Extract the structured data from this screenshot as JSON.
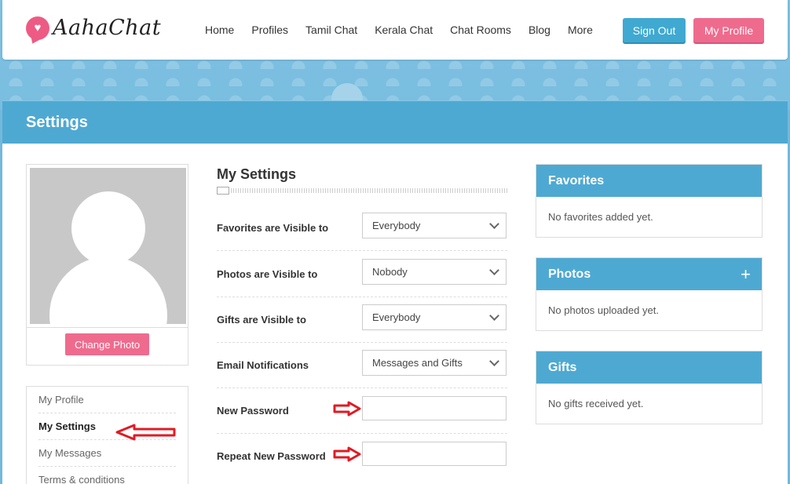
{
  "header": {
    "logo_text": "AahaChat",
    "nav": [
      "Home",
      "Profiles",
      "Tamil Chat",
      "Kerala Chat",
      "Chat Rooms",
      "Blog",
      "More"
    ],
    "sign_out": "Sign Out",
    "my_profile": "My Profile"
  },
  "page_title": "Settings",
  "photo_card": {
    "change_photo": "Change Photo"
  },
  "side_menu": {
    "items": [
      {
        "label": "My Profile",
        "active": false
      },
      {
        "label": "My Settings",
        "active": true
      },
      {
        "label": "My Messages",
        "active": false
      },
      {
        "label": "Terms & conditions",
        "active": false
      }
    ]
  },
  "my_settings": {
    "title": "My Settings",
    "favorites_label": "Favorites are Visible to",
    "favorites_value": "Everybody",
    "photos_label": "Photos are Visible to",
    "photos_value": "Nobody",
    "gifts_label": "Gifts are Visible to",
    "gifts_value": "Everybody",
    "email_label": "Email Notifications",
    "email_value": "Messages and Gifts",
    "new_password_label": "New Password",
    "new_password_value": "",
    "repeat_password_label": "Repeat New Password",
    "repeat_password_value": ""
  },
  "panels": {
    "favorites": {
      "title": "Favorites",
      "body": "No favorites added yet."
    },
    "photos": {
      "title": "Photos",
      "body": "No photos uploaded yet.",
      "add": "+"
    },
    "gifts": {
      "title": "Gifts",
      "body": "No gifts received yet."
    }
  },
  "colors": {
    "brand_blue": "#4ea9d2",
    "brand_pink": "#ef6b8e",
    "annotation_red": "#e01b24"
  },
  "icons": [
    "chat-bubble-heart-icon",
    "chevron-down-icon",
    "plus-icon",
    "red-arrow-annotation-icon"
  ]
}
